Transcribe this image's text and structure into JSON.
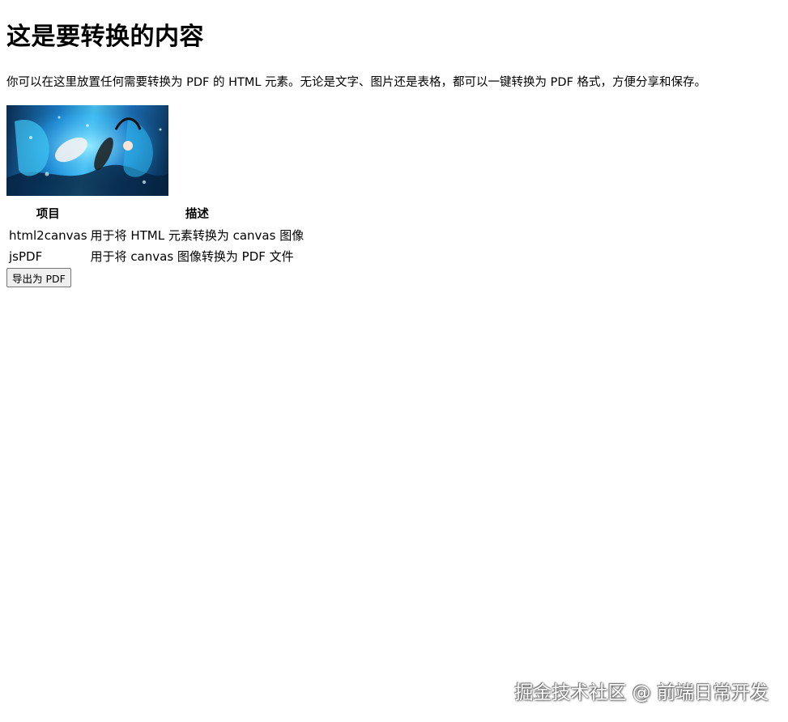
{
  "page": {
    "title": "这是要转换的内容",
    "description": "你可以在这里放置任何需要转换为 PDF 的 HTML 元素。无论是文字、图片还是表格，都可以一键转换为 PDF 格式，方便分享和保存。"
  },
  "table": {
    "headers": [
      "项目",
      "描述"
    ],
    "rows": [
      [
        "html2canvas",
        "用于将 HTML 元素转换为 canvas 图像"
      ],
      [
        "jsPDF",
        "用于将 canvas 图像转换为 PDF 文件"
      ]
    ]
  },
  "export_button": {
    "label": "导出为 PDF"
  },
  "watermark": {
    "text": "掘金技术社区 @ 前端日常开发"
  }
}
